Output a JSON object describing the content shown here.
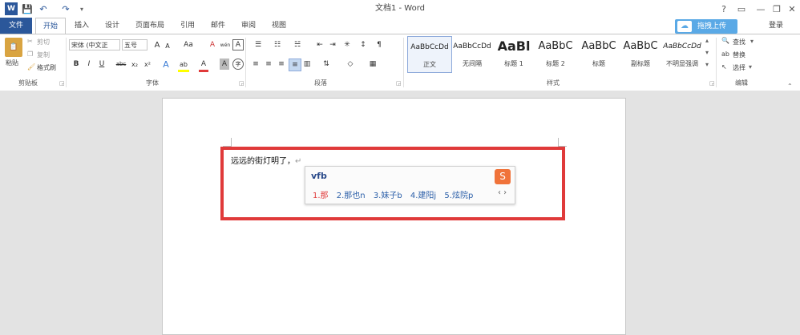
{
  "window": {
    "title": "文档1 - Word",
    "login": "登录",
    "upload_button": "拖拽上传",
    "controls": [
      "?",
      "▭",
      "—",
      "❐",
      "✕"
    ]
  },
  "quick_access": [
    "W",
    "💾",
    "↶",
    "↷",
    "▾"
  ],
  "tabs": [
    {
      "label": "文件"
    },
    {
      "label": "开始"
    },
    {
      "label": "插入"
    },
    {
      "label": "设计"
    },
    {
      "label": "页面布局"
    },
    {
      "label": "引用"
    },
    {
      "label": "邮件"
    },
    {
      "label": "审阅"
    },
    {
      "label": "视图"
    }
  ],
  "clipboard": {
    "paste": "粘贴",
    "cut": "剪切",
    "copy": "复制",
    "format_painter": "格式刷",
    "group_label": "剪贴板"
  },
  "font": {
    "name": "宋体 (中文正",
    "size": "五号",
    "group_label": "字体",
    "grow": "A",
    "shrink": "A",
    "case": "Aa",
    "clear": "A",
    "phonetic": "wén",
    "border": "A",
    "bold": "B",
    "italic": "I",
    "underline": "U",
    "strike": "abc",
    "sub": "x₂",
    "sup": "x²",
    "effects": "A",
    "highlight": "ab",
    "color": "A",
    "shade": "A",
    "enclose": "字"
  },
  "paragraph": {
    "group_label": "段落"
  },
  "styles": {
    "group_label": "样式",
    "items": [
      {
        "sample": "AaBbCcDd",
        "name": "正文"
      },
      {
        "sample": "AaBbCcDd",
        "name": "无间隔"
      },
      {
        "sample": "AaBl",
        "name": "标题 1"
      },
      {
        "sample": "AaBbC",
        "name": "标题 2"
      },
      {
        "sample": "AaBbC",
        "name": "标题"
      },
      {
        "sample": "AaBbC",
        "name": "副标题"
      },
      {
        "sample": "AaBbCcDd",
        "name": "不明显强调"
      }
    ]
  },
  "editing": {
    "group_label": "编辑",
    "find": "查找",
    "replace": "替换",
    "select": "选择"
  },
  "document": {
    "text": "远远的街灯明了，"
  },
  "ime": {
    "code": "vfb",
    "candidates": [
      "1.那",
      "2.那也n",
      "3.妹子b",
      "4.建阳j",
      "5.炫院p"
    ],
    "nav": "‹ ›"
  }
}
